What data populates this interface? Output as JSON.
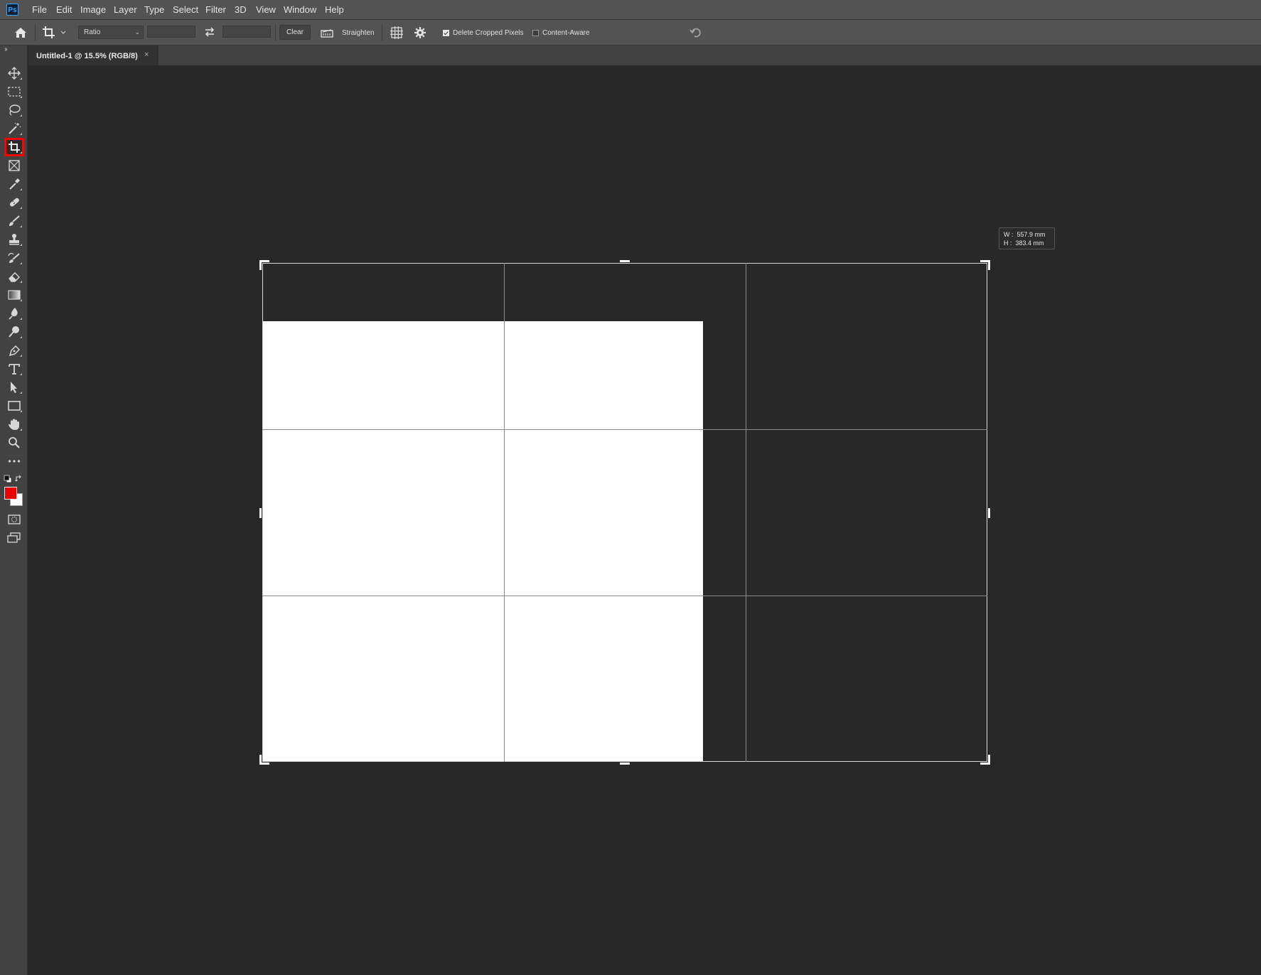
{
  "app": {
    "logo_text": "Ps"
  },
  "menu": [
    "File",
    "Edit",
    "Image",
    "Layer",
    "Type",
    "Select",
    "Filter",
    "3D",
    "View",
    "Window",
    "Help"
  ],
  "options": {
    "ratio_value": "Ratio",
    "width_value": "",
    "height_value": "",
    "clear_label": "Clear",
    "straighten_label": "Straighten",
    "delete_cropped_label": "Delete Cropped Pixels",
    "delete_cropped_checked": true,
    "content_aware_label": "Content-Aware",
    "content_aware_checked": false
  },
  "document_tab": {
    "title": "Untitled-1 @ 15.5% (RGB/8)",
    "close": "×"
  },
  "toolbar": {
    "collapse": "››",
    "tools": [
      {
        "name": "move-tool-icon"
      },
      {
        "name": "marquee-tool-icon"
      },
      {
        "name": "lasso-tool-icon"
      },
      {
        "name": "magic-wand-tool-icon"
      },
      {
        "name": "crop-tool-icon",
        "active": true
      },
      {
        "name": "frame-tool-icon"
      },
      {
        "name": "eyedropper-tool-icon"
      },
      {
        "name": "healing-brush-tool-icon"
      },
      {
        "name": "brush-tool-icon"
      },
      {
        "name": "clone-stamp-tool-icon"
      },
      {
        "name": "history-brush-tool-icon"
      },
      {
        "name": "eraser-tool-icon"
      },
      {
        "name": "gradient-tool-icon"
      },
      {
        "name": "blur-tool-icon"
      },
      {
        "name": "dodge-tool-icon"
      },
      {
        "name": "pen-tool-icon"
      },
      {
        "name": "type-tool-icon"
      },
      {
        "name": "path-selection-tool-icon"
      },
      {
        "name": "rectangle-tool-icon"
      },
      {
        "name": "hand-tool-icon"
      },
      {
        "name": "zoom-tool-icon"
      },
      {
        "name": "more-tools-icon"
      }
    ],
    "foreground_color": "#ee0000",
    "background_color": "#ffffff"
  },
  "crop_readout": {
    "w_label": "W :",
    "w_value": "557.9 mm",
    "h_label": "H :",
    "h_value": "383.4 mm"
  }
}
